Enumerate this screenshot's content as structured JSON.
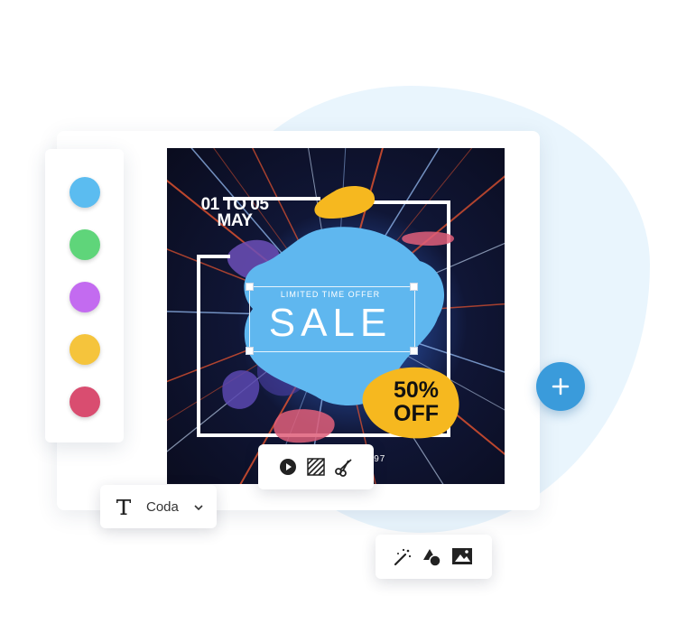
{
  "poster": {
    "date_line1": "01 TO 05",
    "date_line2": "MAY",
    "offer_caption": "LIMITED TIME OFFER",
    "headline": "SALE",
    "discount_line1": "50%",
    "discount_line2": "OFF",
    "address": "123 M                    LLE, NY 5897"
  },
  "palette": {
    "colors": [
      "#5bbcf0",
      "#5fd57a",
      "#c36bf0",
      "#f5c43c",
      "#d94d70"
    ]
  },
  "media_toolbar": {
    "icons": [
      "play-icon",
      "pattern-icon",
      "scissors-icon"
    ]
  },
  "font_toolbar": {
    "icon": "text-T-icon",
    "font_name": "Coda",
    "dropdown_icon": "chevron-down-icon"
  },
  "effects_toolbar": {
    "icons": [
      "magic-wand-icon",
      "shapes-icon",
      "image-icon"
    ]
  },
  "add_button": {
    "icon": "plus-icon"
  },
  "colors": {
    "accent": "#3a9bdb",
    "blob": "#5fb7ef",
    "badge": "#f6b81f",
    "background_blob": "#e9f5fd"
  }
}
